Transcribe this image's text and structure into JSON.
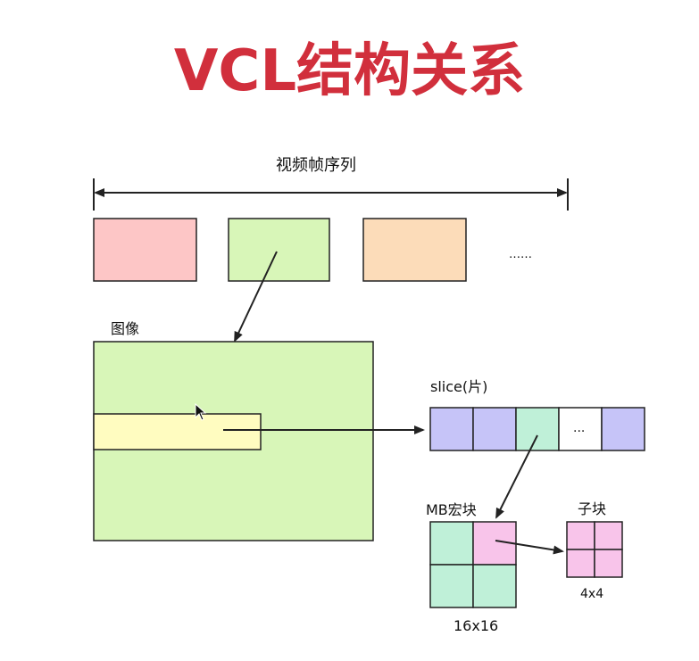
{
  "title": "VCL结构关系",
  "labels": {
    "sequence": "视频帧序列",
    "ellipsis_frames": "……",
    "picture": "图像",
    "slice": "slice(片)",
    "slice_ellipsis": "...",
    "macroblock": "MB宏块",
    "mb_size": "16x16",
    "subblock": "子块",
    "sub_size": "4x4"
  },
  "colors": {
    "title": "#d12f3c",
    "frame1": "#fdc6c6",
    "frame2": "#d8f6b8",
    "frame3": "#fcdcb9",
    "picture": "#d8f6b8",
    "slice_band": "#fffcc0",
    "slice_purple": "#c6c4f8",
    "slice_mint": "#bff0d8",
    "slice_white": "#ffffff",
    "mb_mint": "#bff0d8",
    "mb_pink": "#f8c4ea",
    "sub_pink": "#f8c4ea",
    "stroke": "#222222"
  }
}
